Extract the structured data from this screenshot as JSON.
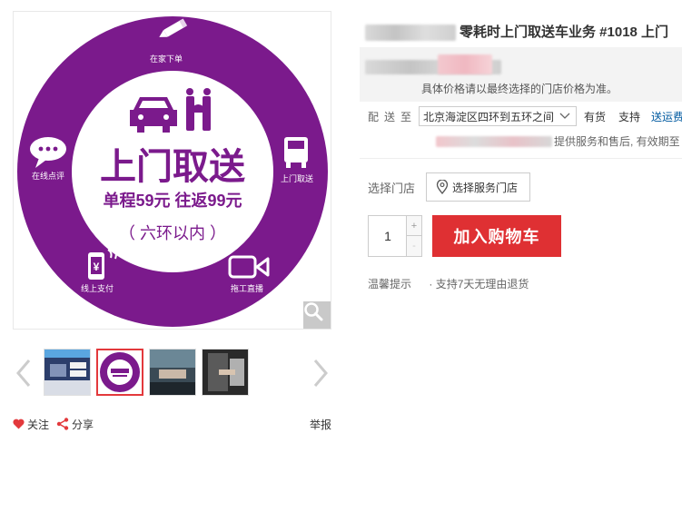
{
  "product": {
    "title": "零耗时上门取送车业务 #1018 上门"
  },
  "gallery": {
    "hero": {
      "center_title": "上门取送",
      "price_line": "单程59元 往返99元",
      "range_line": "（ 六环以内 ）",
      "ring_labels": {
        "top": "在家下单",
        "right": "上门取送",
        "bottom_right": "拖工直播",
        "bottom_left": "线上支付",
        "left": "在线点评"
      }
    },
    "thumb_count": 4
  },
  "social": {
    "follow": "关注",
    "share": "分享",
    "report": "举报"
  },
  "price": {
    "note": "具体价格请以最终选择的门店价格为准。"
  },
  "delivery": {
    "label": "配送至",
    "address": "北京海淀区四环到五环之间",
    "stock": "有货",
    "support": "支持",
    "fee_link": "送运费"
  },
  "service": {
    "text": "提供服务和售后, 有效期至"
  },
  "store": {
    "label": "选择门店",
    "button": "选择服务门店"
  },
  "purchase": {
    "quantity": "1",
    "plus": "+",
    "minus": "-",
    "cart_button": "加入购物车"
  },
  "tips": {
    "label": "温馨提示",
    "text": "· 支持7天无理由退货"
  },
  "colors": {
    "brand_purple": "#7b1a8c",
    "cart_red": "#df3033",
    "link_blue": "#005aa0"
  }
}
